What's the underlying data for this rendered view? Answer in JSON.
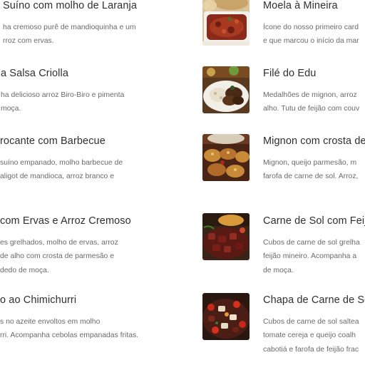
{
  "colors": {
    "title": "#2f2f2f",
    "description": "#6a6a6a",
    "background": "#ffffff"
  },
  "menu": {
    "left": [
      {
        "title": "Suíno com molho de Laranja",
        "lines": [
          "ha cremoso purê de mandioquinha e um",
          "rroz com ervas."
        ]
      },
      {
        "title": "a Salsa Criolla",
        "lines": [
          "ha delicioso arroz Biro-Biro e pimenta",
          "moça."
        ]
      },
      {
        "title": "rocante com Barbecue",
        "lines": [
          "suíno empanado, molho barbecue de",
          "aligot de mandioca, arroz branco e"
        ]
      },
      {
        "title": "com Ervas e Arroz Cremoso",
        "lines": [
          "es grelhados, molho de ervas, arroz",
          "de alho com crosta de parmesão e",
          "dedo de moça."
        ]
      },
      {
        "title": "o ao Chimichurri",
        "lines": [
          "s no azeite envoltos em molho",
          "rri. Acompanha cebolas empanadas fritas."
        ]
      }
    ],
    "right": [
      {
        "title": "Moela à Mineira",
        "image": "moela-dish-photo",
        "lines": [
          "Ícone do nosso primeiro card",
          "e que marcou o início da mar"
        ]
      },
      {
        "title": "Filé do Edu",
        "image": "file-dish-photo",
        "lines": [
          "Medalhões de mignon, arroz",
          "alho. Tutu de feijão com couv"
        ]
      },
      {
        "title": "Mignon com crosta de",
        "image": "mignon-dish-photo",
        "lines": [
          "Mignon, queijo parmesão, m",
          "farofa de carne de sol. Arroz,"
        ]
      },
      {
        "title": "Carne de Sol com Feijã",
        "image": "carne-de-sol-dish-photo",
        "lines": [
          "Cubos de carne de sol grelha",
          "feijão mineiro. Acompanha a",
          "de moça."
        ]
      },
      {
        "title": "Chapa de Carne de Sol",
        "image": "chapa-dish-photo",
        "lines": [
          "Cubos de carne de sol saltea",
          "tomate cereja e queijo coalh",
          "cabotiá e farofa de feijão frac"
        ]
      }
    ]
  }
}
